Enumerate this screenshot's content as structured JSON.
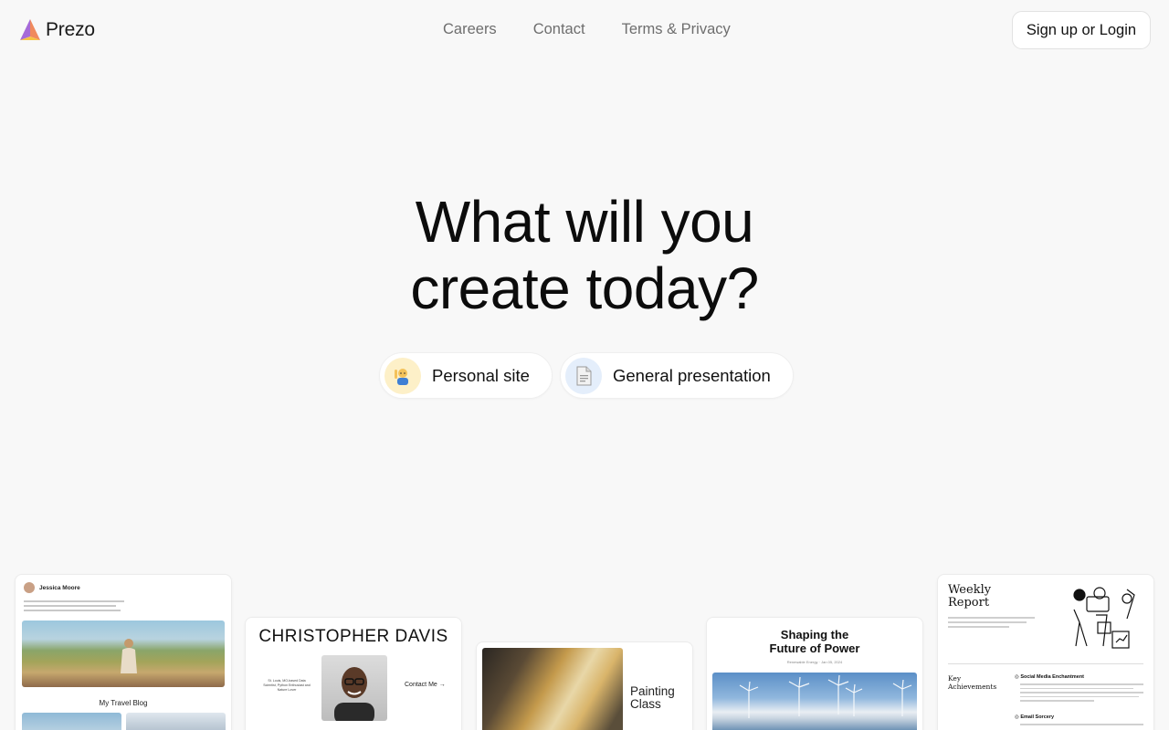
{
  "brand": {
    "name": "Prezo"
  },
  "nav": {
    "links": [
      "Careers",
      "Contact",
      "Terms & Privacy"
    ],
    "cta": "Sign up or Login"
  },
  "hero": {
    "title_line1": "What will you",
    "title_line2": "create today?"
  },
  "options": [
    {
      "label": "Personal site",
      "icon": "person-raising-hand-emoji"
    },
    {
      "label": "General presentation",
      "icon": "document-page-emoji"
    }
  ],
  "templates": {
    "travel_blog": {
      "author": "Jessica Moore",
      "title": "My Travel Blog"
    },
    "portfolio": {
      "name": "CHRISTOPHER DAVIS",
      "bio": "St. Louis, MO-based Data Scientist, Python Enthusiast and Nature Lover",
      "cta": "Contact Me →"
    },
    "painting": {
      "title_line1": "Painting",
      "title_line2": "Class"
    },
    "energy": {
      "title_line1": "Shaping the",
      "title_line2": "Future of Power",
      "subtitle": "Renewable Energy · Jan 05, 2024"
    },
    "report": {
      "title_line1": "Weekly",
      "title_line2": "Report",
      "section": "Key Achievements",
      "heading1": "◎ Social Media Enchantment",
      "heading2": "◎ Email Sorcery"
    }
  },
  "colors": {
    "background": "#f8f8f8",
    "text": "#111111",
    "nav_text": "#6e6e6e",
    "chip_icon_1": "#fdf0c8",
    "chip_icon_2": "#e4eefb"
  }
}
